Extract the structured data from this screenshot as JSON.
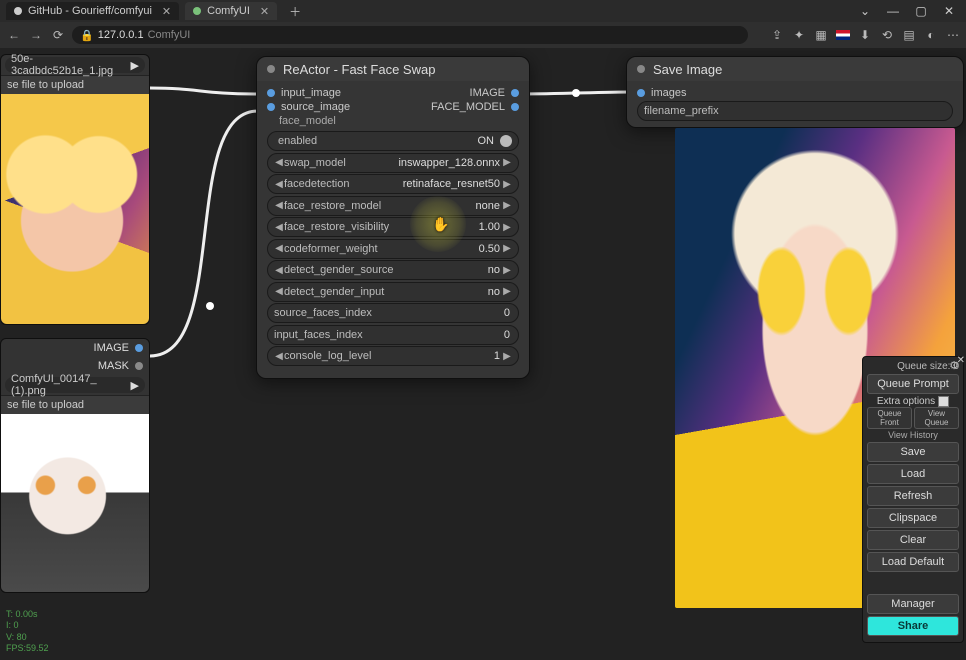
{
  "tabs": [
    {
      "icon": "github",
      "label": "GitHub - Gourieff/comfyui"
    },
    {
      "icon": "comfy",
      "label": "ComfyUI"
    }
  ],
  "window_controls": {
    "min": "—",
    "max": "▢",
    "close": "✕",
    "chev": "⌄"
  },
  "url": {
    "lock": "🔒",
    "host": "127.0.0.1",
    "path": "ComfyUI"
  },
  "toolbar_icons": [
    "share-icon",
    "puzzle-icon",
    "grid-icon",
    "flag-icon",
    "download-icon",
    "refresh-icon",
    "note-icon",
    "person-icon",
    "menu-icon"
  ],
  "nav": {
    "back": "←",
    "fwd": "→",
    "reload": "⟳"
  },
  "node_reactor": {
    "title": "ReActor - Fast Face Swap",
    "inputs": [
      "input_image",
      "source_image"
    ],
    "face_model": "face_model",
    "outputs": [
      "IMAGE",
      "FACE_MODEL"
    ],
    "params": [
      {
        "k": "enabled",
        "v": "ON",
        "type": "toggle"
      },
      {
        "k": "swap_model",
        "v": "inswapper_128.onnx",
        "type": "combo"
      },
      {
        "k": "facedetection",
        "v": "retinaface_resnet50",
        "type": "combo"
      },
      {
        "k": "face_restore_model",
        "v": "none",
        "type": "combo",
        "hl": true
      },
      {
        "k": "face_restore_visibility",
        "v": "1.00",
        "type": "num"
      },
      {
        "k": "codeformer_weight",
        "v": "0.50",
        "type": "num"
      },
      {
        "k": "detect_gender_source",
        "v": "no",
        "type": "combo"
      },
      {
        "k": "detect_gender_input",
        "v": "no",
        "type": "combo"
      },
      {
        "k": "source_faces_index",
        "v": "0",
        "type": "text"
      },
      {
        "k": "input_faces_index",
        "v": "0",
        "type": "text"
      },
      {
        "k": "console_log_level",
        "v": "1",
        "type": "num"
      }
    ]
  },
  "node_save": {
    "title": "Save Image",
    "input": "images",
    "widget": "filename_prefix"
  },
  "node_load1": {
    "filename": "50e-3cadbdc52b1e_1.jpg",
    "upload": "se file to upload"
  },
  "node_load2": {
    "out1": "IMAGE",
    "out2": "MASK",
    "filename": "ComfyUI_00147_ (1).png",
    "upload": "se file to upload"
  },
  "right_panel": {
    "queue_size_label": "Queue size:",
    "queue_size_value": "0",
    "queue_prompt": "Queue Prompt",
    "extra_options": "Extra options",
    "queue_front": "Queue Front",
    "view_queue": "View Queue",
    "view_history": "View History",
    "buttons": [
      "Save",
      "Load",
      "Refresh",
      "Clipspace",
      "Clear",
      "Load Default"
    ],
    "manager": "Manager",
    "share": "Share"
  },
  "stats": {
    "l1": "T: 0.00s",
    "l2": "I: 0",
    "l3": "V: 80",
    "l4": "FPS:59.52"
  }
}
